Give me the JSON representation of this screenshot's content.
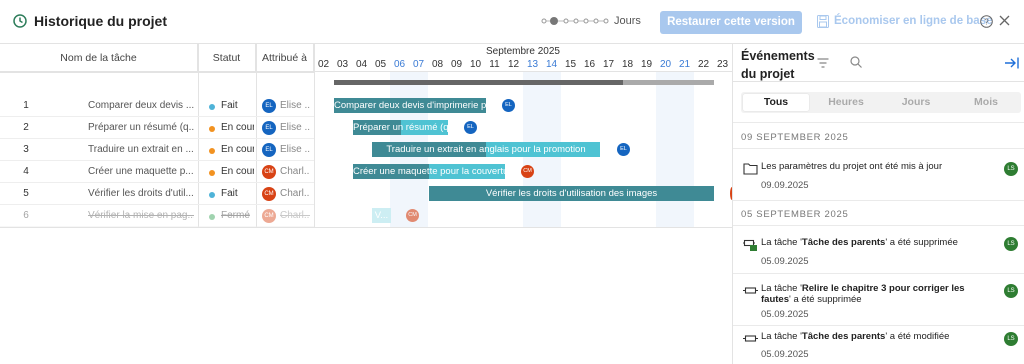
{
  "header": {
    "title": "Historique du projet",
    "zoom_label": "Jours",
    "restore_label": "Restaurer cette version",
    "save_label": "Économiser en ligne de base"
  },
  "grid": {
    "columns": [
      "Nom de la tâche",
      "Statut",
      "Attribué à"
    ],
    "rows": [
      {
        "num": "1",
        "name": "Comparer deux devis ...",
        "status": "Fait",
        "status_color": "#4fb3d8",
        "initials": "EL",
        "avatar_color": "#1565c0",
        "assignee": "Elise ..."
      },
      {
        "num": "2",
        "name": "Préparer un résumé (q...",
        "status": "En cour",
        "status_color": "#f29221",
        "initials": "EL",
        "avatar_color": "#1565c0",
        "assignee": "Elise ..."
      },
      {
        "num": "3",
        "name": "Traduire un extrait en ...",
        "status": "En cour",
        "status_color": "#f29221",
        "initials": "EL",
        "avatar_color": "#1565c0",
        "assignee": "Elise ..."
      },
      {
        "num": "4",
        "name": "Créer une maquette p...",
        "status": "En cour",
        "status_color": "#f29221",
        "initials": "CM",
        "avatar_color": "#d84315",
        "assignee": "Charl..."
      },
      {
        "num": "5",
        "name": "Vérifier les droits d'util...",
        "status": "Fait",
        "status_color": "#4fb3d8",
        "initials": "CM",
        "avatar_color": "#d84315",
        "assignee": "Charl..."
      },
      {
        "num": "6",
        "name": "Vérifier la mise en pag...",
        "status": "Fermé",
        "status_color": "#2e9e4f",
        "initials": "CM",
        "avatar_color": "#d84315",
        "assignee": "Charl..."
      }
    ]
  },
  "timeline": {
    "month": "Septembre 2025",
    "days": [
      "02",
      "03",
      "04",
      "05",
      "06",
      "07",
      "08",
      "09",
      "10",
      "11",
      "12",
      "13",
      "14",
      "15",
      "16",
      "17",
      "18",
      "19",
      "20",
      "21",
      "22",
      "23"
    ],
    "weekend_days": [
      "06",
      "07",
      "13",
      "14",
      "20",
      "21"
    ],
    "summary_progress": 0.76,
    "bars": [
      {
        "label": "Comparer deux devis d'imprimerie p...",
        "initials": "EL",
        "avatar_color": "#1565c0",
        "progress": 1.0
      },
      {
        "label": "Préparer un résumé (q...",
        "initials": "EL",
        "avatar_color": "#1565c0",
        "progress": 0.5
      },
      {
        "label": "Traduire un extrait en anglais pour la promotion",
        "initials": "EL",
        "avatar_color": "#1565c0",
        "progress": 0.5
      },
      {
        "label": "Créer une maquette pour la couverture",
        "initials": "CM",
        "avatar_color": "#d84315",
        "progress": 0.5
      },
      {
        "label": "Vérifier les droits d'utilisation des images",
        "initials": "",
        "avatar_color": "#d84315",
        "progress": 1.0
      },
      {
        "label": "V...",
        "initials": "CM",
        "avatar_color": "#d84315",
        "progress": 0.0
      }
    ]
  },
  "panel": {
    "title": "Événements du projet",
    "tabs": [
      "Tous",
      "Heures",
      "Jours",
      "Mois"
    ],
    "groups": [
      {
        "date": "09 SEPTEMBER 2025"
      },
      {
        "date": "05 SEPTEMBER 2025"
      }
    ],
    "events": [
      {
        "pre": "Les paramètres du projet ont été mis à jour",
        "bold": "",
        "post": "",
        "date": "09.09.2025",
        "initials": "LS",
        "icon": "folder-icon"
      },
      {
        "pre": "La tâche '",
        "bold": "Tâche des parents",
        "post": "' a été supprimée",
        "date": "05.09.2025",
        "initials": "LS",
        "icon": "task-deleted-icon"
      },
      {
        "pre": "La tâche '",
        "bold": "Relire le chapitre 3 pour corriger les fautes",
        "post": "' a été supprimée",
        "date": "05.09.2025",
        "initials": "LS",
        "icon": "task-icon"
      },
      {
        "pre": "La tâche '",
        "bold": "Tâche des parents",
        "post": "' a été modifiée",
        "date": "05.09.2025",
        "initials": "LS",
        "icon": "task-icon"
      }
    ]
  }
}
